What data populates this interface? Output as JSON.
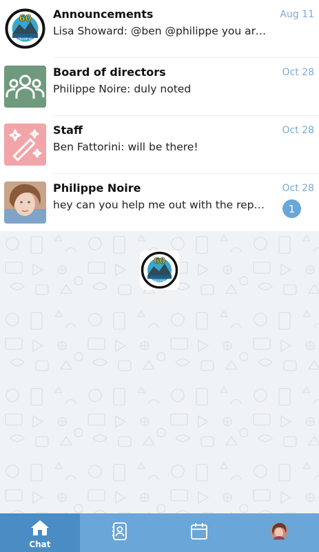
{
  "chats": [
    {
      "title": "Announcements",
      "preview": "Lisa Showard: @ben @philippe you are ...",
      "date": "Aug 11",
      "avatar_icon": "troop-logo-icon"
    },
    {
      "title": "Board of directors",
      "preview": "Philippe Noire: duly noted",
      "date": "Oct 28",
      "avatar_icon": "group-people-icon"
    },
    {
      "title": "Staff",
      "preview": "Ben Fattorini: will be there!",
      "date": "Oct 28",
      "avatar_icon": "magic-wand-icon"
    },
    {
      "title": "Philippe Noire",
      "preview": "hey can you help me out with the repo...",
      "date": "Oct 28",
      "unread": "1",
      "avatar_icon": "profile-photo"
    }
  ],
  "tabs": [
    {
      "label": "Chat",
      "icon": "home-icon",
      "active": true
    },
    {
      "label": "",
      "icon": "contacts-icon",
      "active": false
    },
    {
      "label": "",
      "icon": "calendar-icon",
      "active": false
    },
    {
      "label": "",
      "icon": "user-avatar",
      "active": false
    }
  ],
  "colors": {
    "accent": "#6aa6d8",
    "accent_dark": "#4a8cc4",
    "date_text": "#7aa9d4",
    "board_avatar": "#6f9a7e",
    "staff_avatar": "#f2a5a8",
    "chat_background": "#f0f3f6"
  }
}
